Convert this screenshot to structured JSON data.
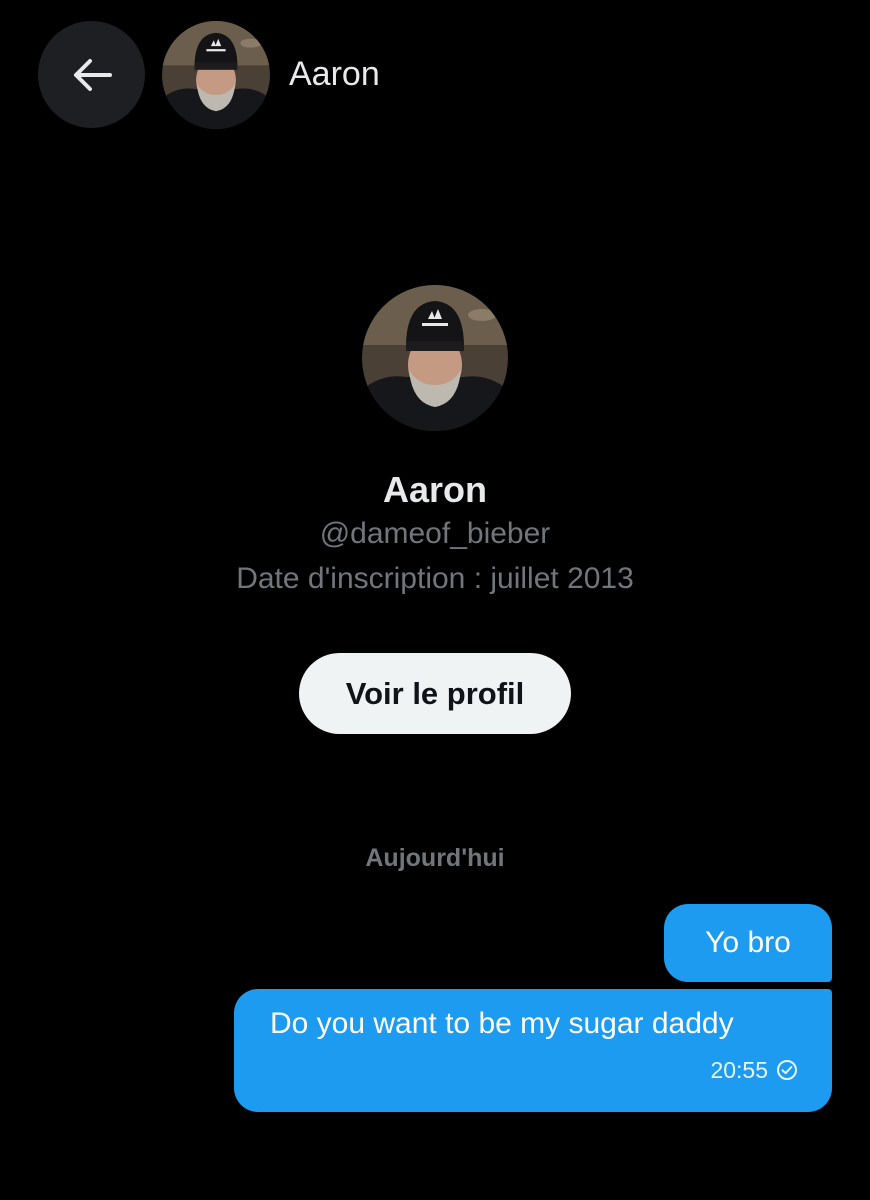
{
  "header": {
    "back_icon": "arrow-left-icon",
    "contact_name": "Aaron"
  },
  "profile": {
    "name": "Aaron",
    "handle": "@dameof_bieber",
    "joined": "Date d'inscription : juillet 2013",
    "view_profile_label": "Voir le profil"
  },
  "conversation": {
    "date_divider": "Aujourd'hui",
    "messages": [
      {
        "text": "Yo bro",
        "time": "",
        "direction": "sent"
      },
      {
        "text": "Do you want to be my sugar daddy",
        "time": "20:55",
        "status_icon": "check-circle-icon",
        "direction": "sent"
      }
    ]
  },
  "colors": {
    "background": "#000000",
    "accent": "#1d9bf0",
    "secondary_text": "#71767b",
    "button_bg": "#eff3f4"
  }
}
